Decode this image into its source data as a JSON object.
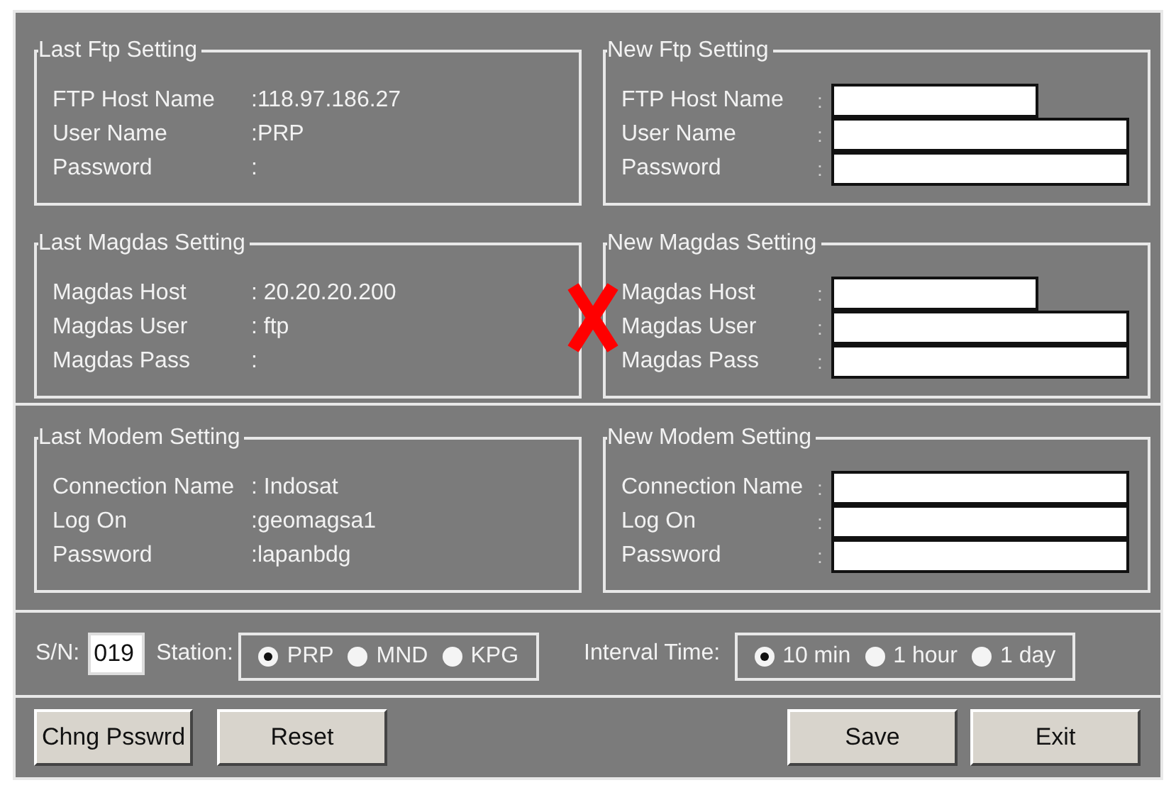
{
  "groups": [
    {
      "title": "Last Ftp Setting",
      "kind": "last",
      "rows": [
        {
          "label": "FTP Host Name",
          "value": ":118.97.186.27"
        },
        {
          "label": "User Name",
          "value": ":PRP"
        },
        {
          "label": "Password",
          "value": ":"
        }
      ]
    },
    {
      "title": "New Ftp Setting",
      "kind": "new",
      "rows": [
        {
          "label": "FTP Host Name",
          "sep": ":",
          "kind": "short"
        },
        {
          "label": "User Name",
          "sep": ":",
          "kind": "long"
        },
        {
          "label": "Password",
          "sep": ":",
          "kind": "long"
        }
      ]
    },
    {
      "title": "Last Magdas Setting",
      "kind": "last",
      "rows": [
        {
          "label": "Magdas Host",
          "value": ": 20.20.20.200"
        },
        {
          "label": "Magdas User",
          "value": ": ftp"
        },
        {
          "label": "Magdas Pass",
          "value": ":"
        }
      ]
    },
    {
      "title": "New Magdas Setting",
      "kind": "new",
      "rows": [
        {
          "label": "Magdas Host",
          "sep": ":",
          "kind": "short"
        },
        {
          "label": "Magdas User",
          "sep": ":",
          "kind": "long"
        },
        {
          "label": "Magdas Pass",
          "sep": ":",
          "kind": "long"
        }
      ]
    },
    {
      "title": "Last Modem Setting",
      "kind": "last",
      "rows": [
        {
          "label": "Connection Name",
          "value": ": Indosat"
        },
        {
          "label": "Log On",
          "value": ":geomagsa1"
        },
        {
          "label": "Password",
          "value": ":lapanbdg"
        }
      ]
    },
    {
      "title": "New Modem Setting",
      "kind": "new",
      "rows": [
        {
          "label": "Connection Name",
          "sep": ":",
          "kind": "long"
        },
        {
          "label": "Log On",
          "sep": ":",
          "kind": "long"
        },
        {
          "label": "Password",
          "sep": ":",
          "kind": "long"
        }
      ]
    }
  ],
  "sn": {
    "label": "S/N:",
    "value": "019"
  },
  "station": {
    "label": "Station:",
    "options": [
      {
        "label": "PRP",
        "selected": true
      },
      {
        "label": "MND",
        "selected": false
      },
      {
        "label": "KPG",
        "selected": false
      }
    ]
  },
  "interval": {
    "label": "Interval Time:",
    "options": [
      {
        "label": "10 min",
        "selected": true
      },
      {
        "label": "1 hour",
        "selected": false
      },
      {
        "label": "1 day",
        "selected": false
      }
    ]
  },
  "buttons_left": [
    "Chng Psswrd",
    "Reset"
  ],
  "buttons_right": [
    "Save",
    "Exit"
  ]
}
